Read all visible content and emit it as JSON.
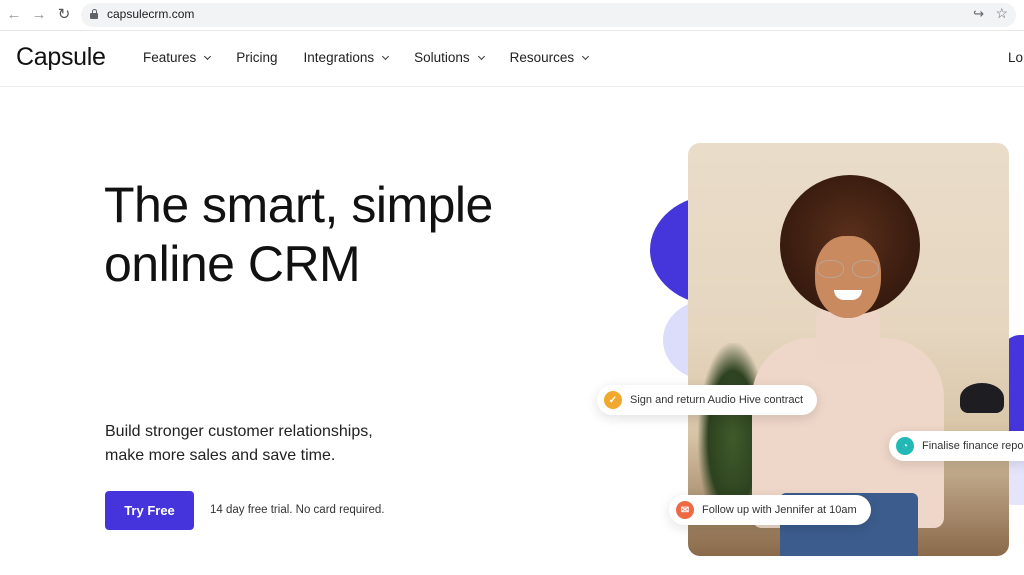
{
  "browser": {
    "url": "capsulecrm.com",
    "icons": {
      "back": "arrow-left-icon",
      "forward": "arrow-right-icon",
      "reload": "reload-icon",
      "lock": "lock-icon",
      "share": "share-icon",
      "bookmark": "star-icon"
    }
  },
  "header": {
    "logo": "Capsule",
    "nav": [
      {
        "label": "Features",
        "dropdown": true
      },
      {
        "label": "Pricing",
        "dropdown": false
      },
      {
        "label": "Integrations",
        "dropdown": true
      },
      {
        "label": "Solutions",
        "dropdown": true
      },
      {
        "label": "Resources",
        "dropdown": true
      }
    ],
    "login_partial": "Lo"
  },
  "hero": {
    "title_line1": "The smart, simple",
    "title_line2": "online CRM",
    "subtitle_line1": "Build stronger customer relationships,",
    "subtitle_line2": "make more sales and save time.",
    "cta_label": "Try Free",
    "trial_note": "14 day free trial. No card required."
  },
  "visual": {
    "chips": [
      {
        "text": "Sign and return Audio Hive contract",
        "icon": "check-icon",
        "color": "#f0a92e"
      },
      {
        "text": "Finalise finance repo",
        "icon": "pie-chart-icon",
        "color": "#22b8b5"
      },
      {
        "text": "Follow up with Jennifer at 10am",
        "icon": "envelope-icon",
        "color": "#ee6a45"
      }
    ]
  },
  "colors": {
    "brand": "#4533db",
    "blob_light": "#dcdcfb"
  }
}
